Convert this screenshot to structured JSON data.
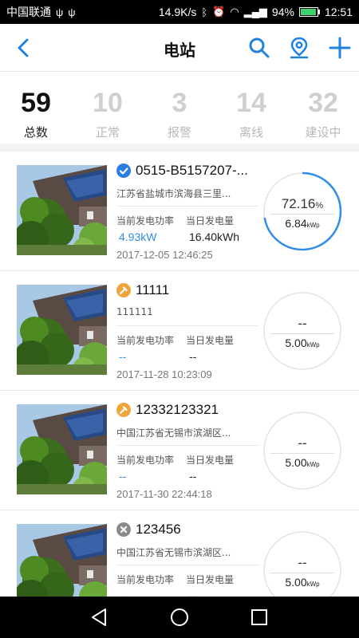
{
  "status_bar": {
    "carrier": "中国联通",
    "left_icons": [
      "usb-icon",
      "usb-icon"
    ],
    "net_speed": "14.9K/s",
    "battery": "94%",
    "battery_level": 0.94,
    "time": "12:51"
  },
  "header": {
    "title": "电站",
    "accent": "#1f82e0"
  },
  "stats": [
    {
      "value": "59",
      "label": "总数"
    },
    {
      "value": "10",
      "label": "正常"
    },
    {
      "value": "3",
      "label": "报警"
    },
    {
      "value": "14",
      "label": "离线"
    },
    {
      "value": "32",
      "label": "建设中"
    }
  ],
  "stations": [
    {
      "name": "0515-B5157207-...",
      "status_icon": "check-icon",
      "status_color": "#2a7de1",
      "address": "江苏省盐城市滨海县三里...",
      "power_label": "当前发电功率",
      "power_value": "4.93kW",
      "energy_label": "当日发电量",
      "energy_value": "16.40kWh",
      "timestamp": "2017-12-05 12:46:25",
      "percent": "72.16",
      "percent_unit": "%",
      "ratio": 0.7216,
      "capacity": "6.84",
      "capacity_unit": "kWp"
    },
    {
      "name": "11111",
      "status_icon": "construction-icon",
      "status_color": "#f0a53a",
      "address": "111111",
      "power_label": "当前发电功率",
      "power_value": "--",
      "energy_label": "当日发电量",
      "energy_value": "--",
      "timestamp": "2017-11-28 10:23:09",
      "percent": "--",
      "percent_unit": "",
      "ratio": 0,
      "capacity": "5.00",
      "capacity_unit": "kWp"
    },
    {
      "name": "12332123321",
      "status_icon": "construction-icon",
      "status_color": "#f0a53a",
      "address": "中国江苏省无锡市滨湖区...",
      "power_label": "当前发电功率",
      "power_value": "--",
      "energy_label": "当日发电量",
      "energy_value": "--",
      "timestamp": "2017-11-30 22:44:18",
      "percent": "--",
      "percent_unit": "",
      "ratio": 0,
      "capacity": "5.00",
      "capacity_unit": "kWp"
    },
    {
      "name": "123456",
      "status_icon": "offline-icon",
      "status_color": "#8a8a8a",
      "address": "中国江苏省无锡市滨湖区...",
      "power_label": "当前发电功率",
      "power_value": "--",
      "energy_label": "当日发电量",
      "energy_value": "--",
      "timestamp": "",
      "percent": "--",
      "percent_unit": "",
      "ratio": 0,
      "capacity": "5.00",
      "capacity_unit": "kWp"
    }
  ]
}
